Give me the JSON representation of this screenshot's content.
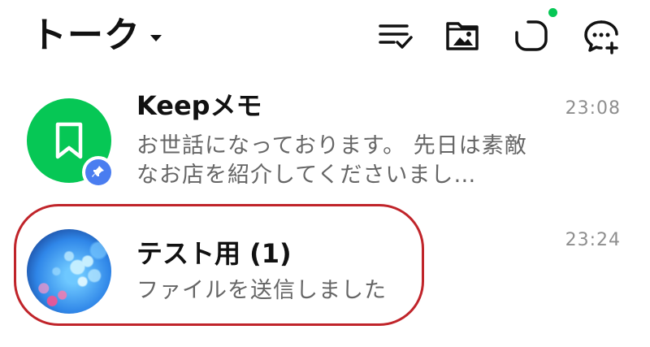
{
  "header": {
    "title": "トーク",
    "icons": [
      "sort-list-icon",
      "album-icon",
      "open-chat-icon",
      "new-chat-icon"
    ],
    "notify_dot_color": "#06c755"
  },
  "chats": [
    {
      "name": "Keepメモ",
      "preview": "お世話になっております。 先日は素敵なお店を紹介してくださいまし…",
      "time": "23:08",
      "avatar": "bookmark-icon",
      "avatar_color": "#06c755",
      "pinned": true
    },
    {
      "name": "テスト用 (1)",
      "preview": "ファイルを送信しました",
      "time": "23:24",
      "avatar": "bokeh-photo"
    }
  ],
  "colors": {
    "highlight": "#c0242a",
    "pin_badge": "#4a7df0"
  }
}
